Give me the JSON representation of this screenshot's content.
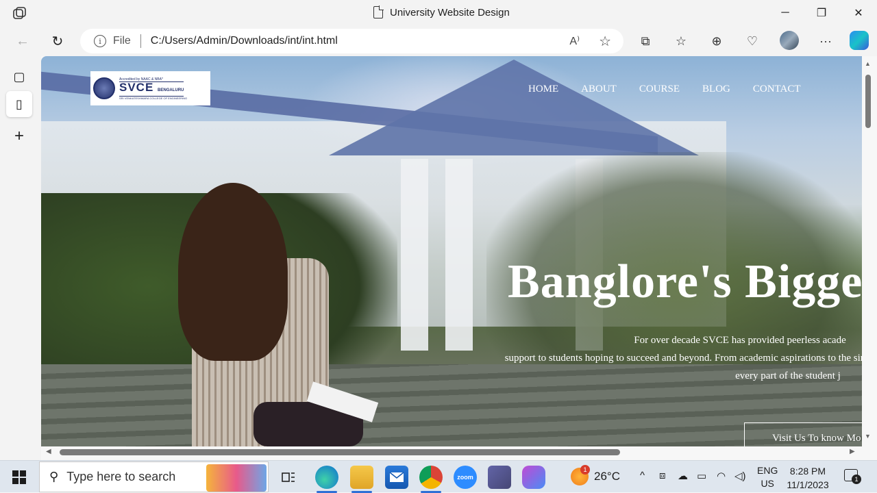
{
  "window": {
    "title": "University Website Design",
    "minimize": "─",
    "maximize": "❐",
    "close": "✕"
  },
  "addressbar": {
    "info_label": "i",
    "scheme": "File",
    "url": "C:/Users/Admin/Downloads/int/int.html",
    "read_aloud": "A⁾",
    "favorite": "☆"
  },
  "nav": {
    "back": "←",
    "reload": "↻"
  },
  "toolbar": {
    "split": "⧉",
    "favorites": "☆",
    "collections": "⊕",
    "health": "♡",
    "more": "···"
  },
  "sidebar": {
    "tabs_icon": "▢",
    "page_icon": "▯",
    "add": "+"
  },
  "site": {
    "logo": {
      "accreditation": "Accredited by NAAC & NBA*",
      "name": "SVCE",
      "city": "BENGALURU",
      "college": "SRI VENKATESHWARA COLLEGE OF ENGINEERING"
    },
    "menu": [
      "HOME",
      "ABOUT",
      "COURSE",
      "BLOG",
      "CONTACT"
    ],
    "headline": "Banglore's Bigge",
    "description_lines": [
      "For over decade SVCE has provided peerless acade",
      "support to students hoping to succeed and beyond. From academic aspirations to the sin",
      "every part of the student j"
    ],
    "cta": "Visit Us To know Mo"
  },
  "scrollbars": {
    "up": "▲",
    "down": "▼",
    "left": "◀",
    "right": "▶"
  },
  "taskbar": {
    "search_placeholder": "Type here to search",
    "search_icon": "⚲",
    "zoom_label": "zoom",
    "weather_temp": "26°C",
    "weather_badge": "1",
    "tray_chevron": "^",
    "lang_top": "ENG",
    "lang_bottom": "US",
    "time": "8:28 PM",
    "date": "11/1/2023",
    "notification_count": "1"
  }
}
